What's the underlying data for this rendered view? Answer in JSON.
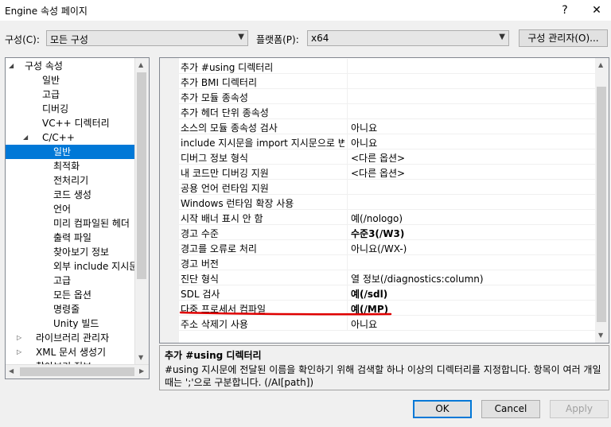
{
  "window": {
    "title": "Engine 속성 페이지",
    "help_glyph": "?",
    "close_glyph": "✕"
  },
  "config": {
    "label": "구성(C):",
    "value": "모든 구성",
    "platform_label": "플랫폼(P):",
    "platform_value": "x64",
    "manager_button": "구성 관리자(O)..."
  },
  "tree": {
    "items": [
      {
        "label": "구성 속성",
        "expander": "◢"
      },
      {
        "label": "일반"
      },
      {
        "label": "고급"
      },
      {
        "label": "디버깅"
      },
      {
        "label": "VC++ 디렉터리"
      },
      {
        "label": "C/C++",
        "expander": "◢"
      },
      {
        "label": "일반",
        "selected": true
      },
      {
        "label": "최적화"
      },
      {
        "label": "전처리기"
      },
      {
        "label": "코드 생성"
      },
      {
        "label": "언어"
      },
      {
        "label": "미리 컴파일된 헤더"
      },
      {
        "label": "출력 파일"
      },
      {
        "label": "찾아보기 정보"
      },
      {
        "label": "외부 include 지시문"
      },
      {
        "label": "고급"
      },
      {
        "label": "모든 옵션"
      },
      {
        "label": "명령줄"
      },
      {
        "label": "Unity 빌드"
      },
      {
        "label": "라이브러리 관리자",
        "expander": "▷"
      },
      {
        "label": "XML 문서 생성기",
        "expander": "▷"
      },
      {
        "label": "찾아보기 정보",
        "expander": "▷"
      }
    ]
  },
  "grid": {
    "rows": [
      {
        "name": "추가 #using 디렉터리",
        "value": ""
      },
      {
        "name": "추가 BMI 디렉터리",
        "value": ""
      },
      {
        "name": "추가 모듈 종속성",
        "value": ""
      },
      {
        "name": "추가 헤더 단위 종속성",
        "value": ""
      },
      {
        "name": "소스의 모듈 종속성 검사",
        "value": "아니요"
      },
      {
        "name": "include 지시문을 import 지시문으로 변환",
        "value": "아니요"
      },
      {
        "name": "디버그 정보 형식",
        "value": "<다른 옵션>"
      },
      {
        "name": "내 코드만 디버깅 지원",
        "value": "<다른 옵션>"
      },
      {
        "name": "공용 언어 런타임 지원",
        "value": ""
      },
      {
        "name": "Windows 런타임 확장 사용",
        "value": ""
      },
      {
        "name": "시작 배너 표시 안 함",
        "value": "예(/nologo)"
      },
      {
        "name": "경고 수준",
        "value": "수준3(/W3)",
        "bold": true
      },
      {
        "name": "경고를 오류로 처리",
        "value": "아니요(/WX-)"
      },
      {
        "name": "경고 버전",
        "value": ""
      },
      {
        "name": "진단 형식",
        "value": "열 정보(/diagnostics:column)"
      },
      {
        "name": "SDL 검사",
        "value": "예(/sdl)",
        "bold": true
      },
      {
        "name": "다중 프로세서 컴파일",
        "value": "예(/MP)",
        "bold": true
      },
      {
        "name": "주소 삭제기 사용",
        "value": "아니요"
      }
    ]
  },
  "description": {
    "title": "추가 #using 디렉터리",
    "text": "#using 지시문에 전달된 이름을 확인하기 위해 검색할 하나 이상의 디렉터리를 지정합니다. 항목이 여러 개일 때는 ';'으로 구분합니다. (/AI[path])"
  },
  "buttons": {
    "ok": "OK",
    "cancel": "Cancel",
    "apply": "Apply"
  },
  "annotation_color": "#e00000"
}
